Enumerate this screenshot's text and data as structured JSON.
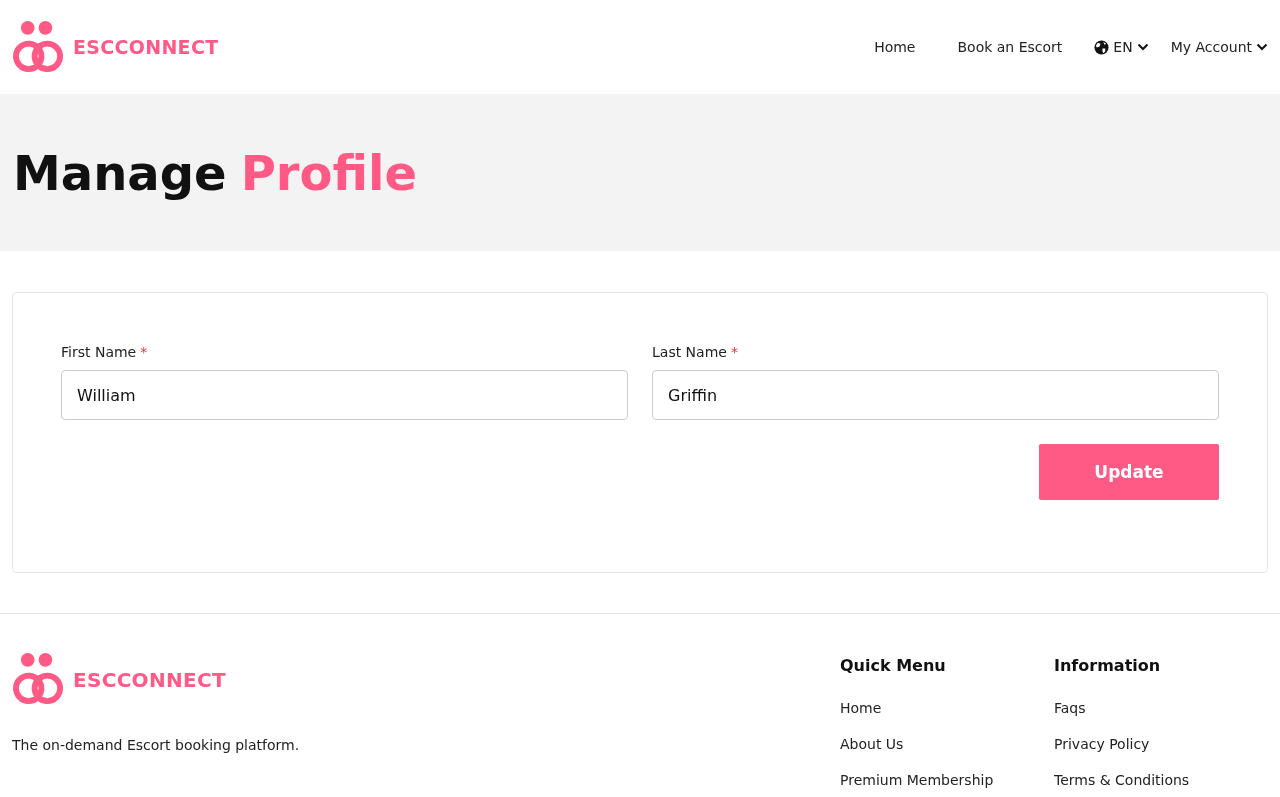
{
  "header": {
    "brand": "ESCCONNECT",
    "nav": [
      {
        "label": "Home",
        "kind": "link"
      },
      {
        "label": "Book an Escort",
        "kind": "link"
      },
      {
        "label": "EN",
        "kind": "language"
      },
      {
        "label": "My Account",
        "kind": "dropdown"
      }
    ]
  },
  "hero": {
    "title_lead": "Manage",
    "title_accent": "Profile"
  },
  "form": {
    "fields": [
      {
        "label": "First Name",
        "required_mark": "*",
        "value": "William"
      },
      {
        "label": "Last Name",
        "required_mark": "*",
        "value": "Griffin"
      }
    ],
    "button": "Update"
  },
  "footer": {
    "brand": "ESCCONNECT",
    "tagline": "The on-demand Escort booking platform.",
    "columns": [
      {
        "heading": "Quick Menu",
        "links": [
          "Home",
          "About Us",
          "Premium Membership"
        ]
      },
      {
        "heading": "Information",
        "links": [
          "Faqs",
          "Privacy Policy",
          "Terms & Conditions"
        ]
      }
    ]
  }
}
